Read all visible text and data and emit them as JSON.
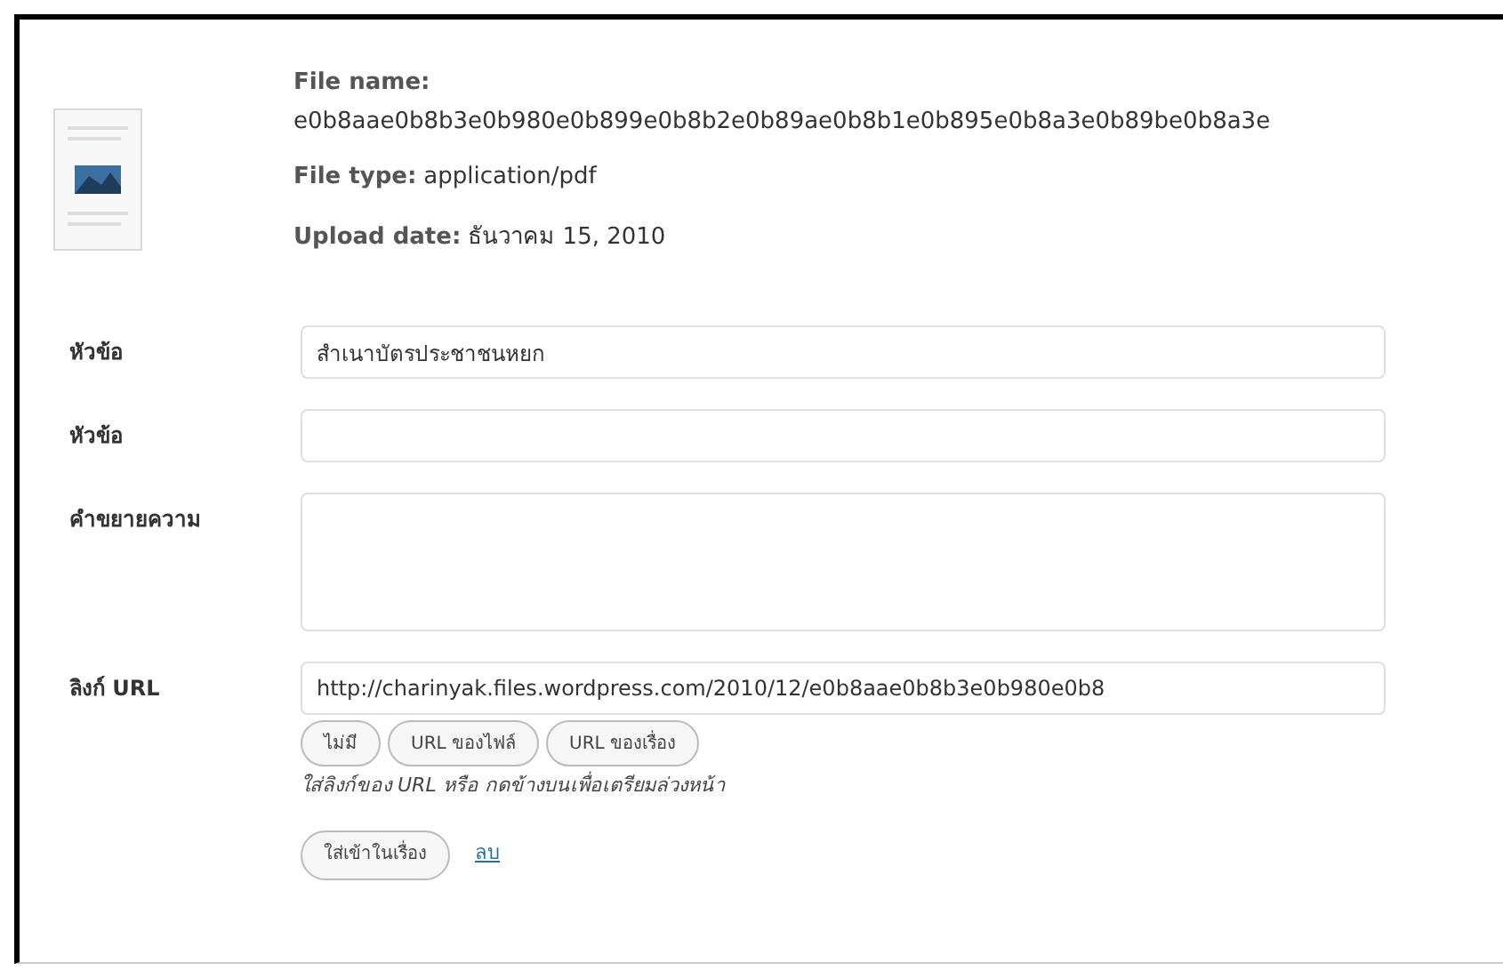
{
  "file_info": {
    "name_label": "File name:",
    "name_value": "e0b8aae0b8b3e0b980e0b899e0b8b2e0b89ae0b8b1e0b895e0b8a3e0b89be0b8a3e",
    "type_label": "File type:",
    "type_value": "application/pdf",
    "date_label": "Upload date:",
    "date_value": "ธันวาคม 15, 2010"
  },
  "fields": [
    {
      "label": "หัวข้อ",
      "kind": "input",
      "value": "สำเนาบัตรประชาชนหยก"
    },
    {
      "label": "หัวข้อ",
      "kind": "input"
    },
    {
      "label": "คำขยายความ",
      "kind": "textarea"
    },
    {
      "label": "ลิงก์ URL",
      "kind": "url",
      "value": "http://charinyak.files.wordpress.com/2010/12/e0b8aae0b8b3e0b980e0b8"
    }
  ],
  "link_buttons": [
    "ไม่มี",
    "URL ของไฟล์",
    "URL ของเรื่อง"
  ],
  "help_text": "ใส่ลิงก์ของ URL หรือ กดข้างบนเพื่อเตรียมล่วงหน้า",
  "insert_button": "ใส่เข้าในเรื่อง",
  "delete_link": "ลบ"
}
